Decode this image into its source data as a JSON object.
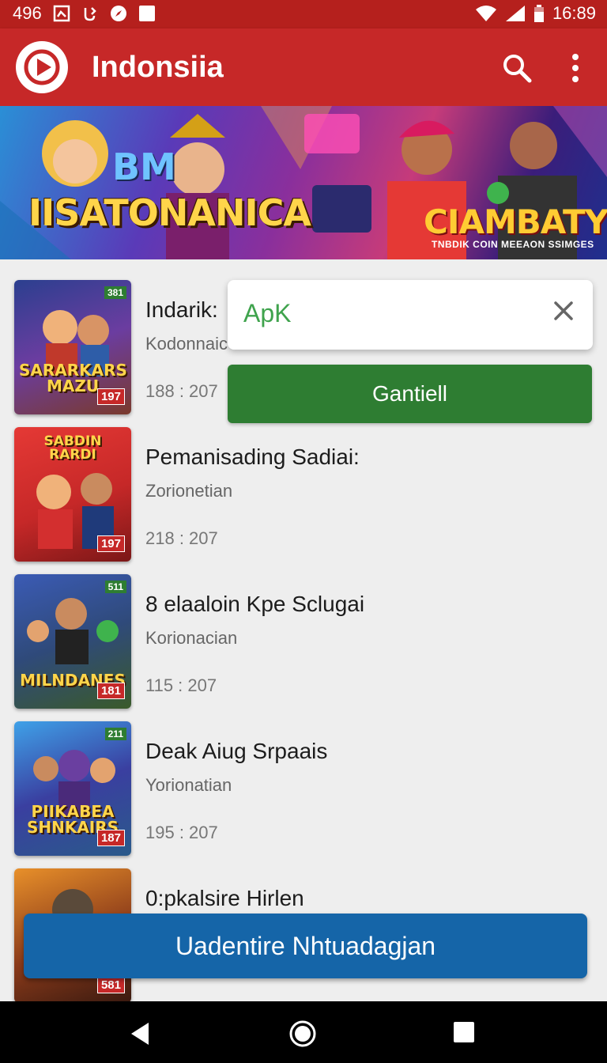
{
  "status_bar": {
    "left_number": "496",
    "time": "16:89"
  },
  "app_bar": {
    "title": "Indonsiia"
  },
  "banner": {
    "top_text": "BM",
    "main_text": "IISATONANICA",
    "right_text": "CIAMBATY",
    "right_tagline": "TNBDIK COIN MEEAON SSIMGES"
  },
  "list": {
    "items": [
      {
        "title": "Indarik:",
        "subtitle": "Kodonnaic",
        "meta": "188 : 207",
        "thumb_title": "SARARKARS MAZU",
        "thumb_badge_top": "381",
        "thumb_badge": "197"
      },
      {
        "title": "Pemanisading Sadiai:",
        "subtitle": "Zorionetian",
        "meta": "218 : 207",
        "thumb_title": "SABDIN RARDI",
        "thumb_badge_top": "",
        "thumb_badge": "197"
      },
      {
        "title": "8 elaaloin  Kpe Sclugai",
        "subtitle": "Korionacian",
        "meta": "115 : 207",
        "thumb_title": "MILNDANES",
        "thumb_badge_top": "511",
        "thumb_badge": "181"
      },
      {
        "title": "Deak Aiug Srpaais",
        "subtitle": "Yorionatian",
        "meta": "195 : 207",
        "thumb_title": "PIIKABEA SHNKAIRS",
        "thumb_badge_top": "211",
        "thumb_badge": "187"
      },
      {
        "title": "0:pkalsire Hirlen",
        "subtitle": "",
        "meta": "",
        "thumb_title": "",
        "thumb_badge_top": "",
        "thumb_badge": "581"
      }
    ]
  },
  "apk_popup": {
    "text": "ApK",
    "action_label": "Gantiell"
  },
  "cta": {
    "label": "Uadentire Nhtuadagjan"
  },
  "colors": {
    "app_bar": "#c62828",
    "status_bar": "#b5201d",
    "action_green": "#2e7d32",
    "apk_text_green": "#3fa34d",
    "cta_blue": "#1565a8"
  }
}
